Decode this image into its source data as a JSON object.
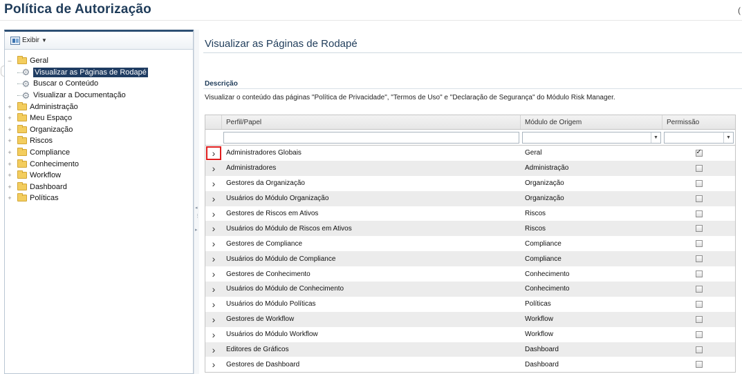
{
  "page": {
    "title": "Política de Autorização",
    "corner_char": "("
  },
  "sidebar": {
    "toolbar": {
      "exibir_label": "Exibir"
    },
    "tree": [
      {
        "label": "Geral",
        "icon": "folder-icon",
        "expanded": true,
        "children": [
          {
            "label": "Visualizar as Páginas de Rodapé",
            "icon": "gear-icon",
            "selected": true
          },
          {
            "label": "Buscar o Conteúdo",
            "icon": "gear-icon"
          },
          {
            "label": "Visualizar a Documentação",
            "icon": "gear-icon"
          }
        ]
      },
      {
        "label": "Administração",
        "icon": "folder-icon"
      },
      {
        "label": "Meu Espaço",
        "icon": "folder-icon"
      },
      {
        "label": "Organização",
        "icon": "folder-icon"
      },
      {
        "label": "Riscos",
        "icon": "folder-icon"
      },
      {
        "label": "Compliance",
        "icon": "folder-icon"
      },
      {
        "label": "Conhecimento",
        "icon": "folder-icon"
      },
      {
        "label": "Workflow",
        "icon": "folder-icon"
      },
      {
        "label": "Dashboard",
        "icon": "folder-icon"
      },
      {
        "label": "Políticas",
        "icon": "folder-icon"
      }
    ]
  },
  "main": {
    "title": "Visualizar as Páginas de Rodapé",
    "description_heading": "Descrição",
    "description_text": "Visualizar o conteúdo das páginas \"Política de Privacidade\", \"Termos de Uso\" e \"Declaração de Segurança\" do Módulo Risk Manager.",
    "grid": {
      "columns": [
        "Perfil/Papel",
        "Módulo de Origem",
        "Permissão"
      ],
      "filters": {
        "perfil": "",
        "modulo": "",
        "permissao": ""
      },
      "rows": [
        {
          "perfil": "Administradores Globais",
          "modulo": "Geral",
          "permissao": true,
          "highlight": true
        },
        {
          "perfil": "Administradores",
          "modulo": "Administração",
          "permissao": false
        },
        {
          "perfil": "Gestores da Organização",
          "modulo": "Organização",
          "permissao": false
        },
        {
          "perfil": "Usuários do Módulo Organização",
          "modulo": "Organização",
          "permissao": false
        },
        {
          "perfil": "Gestores de Riscos em Ativos",
          "modulo": "Riscos",
          "permissao": false
        },
        {
          "perfil": "Usuários do Módulo de Riscos em Ativos",
          "modulo": "Riscos",
          "permissao": false
        },
        {
          "perfil": "Gestores de Compliance",
          "modulo": "Compliance",
          "permissao": false
        },
        {
          "perfil": "Usuários do Módulo de Compliance",
          "modulo": "Compliance",
          "permissao": false
        },
        {
          "perfil": "Gestores de Conhecimento",
          "modulo": "Conhecimento",
          "permissao": false
        },
        {
          "perfil": "Usuários do Módulo de Conhecimento",
          "modulo": "Conhecimento",
          "permissao": false
        },
        {
          "perfil": "Usuários do Módulo Políticas",
          "modulo": "Políticas",
          "permissao": false
        },
        {
          "perfil": "Gestores de Workflow",
          "modulo": "Workflow",
          "permissao": false
        },
        {
          "perfil": "Usuários do Módulo Workflow",
          "modulo": "Workflow",
          "permissao": false
        },
        {
          "perfil": "Editores de Gráficos",
          "modulo": "Dashboard",
          "permissao": false
        },
        {
          "perfil": "Gestores de Dashboard",
          "modulo": "Dashboard",
          "permissao": false
        }
      ]
    }
  },
  "colors": {
    "title": "#1f3c5a",
    "selected_bg": "#1f3c62",
    "highlight_outline": "#e01e1e",
    "alt_row": "#ececec"
  }
}
